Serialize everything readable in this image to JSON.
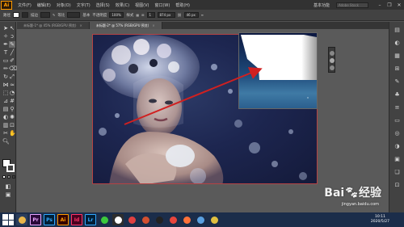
{
  "app": {
    "logo": "Ai",
    "menu": [
      "文件(F)",
      "编辑(E)",
      "对象(O)",
      "文字(T)",
      "选择(S)",
      "效果(C)",
      "视图(V)",
      "窗口(W)",
      "帮助(H)"
    ],
    "workspace": "基本功能",
    "search_placeholder": "Adobe Stock",
    "window_buttons": [
      "minimize-icon",
      "restore-icon",
      "close-icon"
    ]
  },
  "control_bar": {
    "object_label": "路径",
    "stroke_label": "描边",
    "stroke_weight": "",
    "brush_label": "等比",
    "brush_size": "",
    "style_label": "基本",
    "opacity_label": "不透明度",
    "opacity_value": "100%",
    "style2_label": "样式",
    "x_value": "1",
    "y_value": "874 px",
    "w_value": "46 px"
  },
  "doc_tabs": [
    {
      "label": "未标题-1* @ 45% (RGB/GPU 预览)",
      "active": false
    },
    {
      "label": "未标题-2* @ 57% (RGB/GPU 预览)",
      "active": true
    }
  ],
  "status_bar": {
    "zoom": "57%",
    "tool_name": "画板导航"
  },
  "taskbar": {
    "apps": [
      {
        "icon": "folder-icon",
        "label": "",
        "color": "#e9b64a",
        "bg": "#2a3e5e"
      },
      {
        "icon": "premiere-icon",
        "label": "Pr",
        "color": "#e8a4ff",
        "bg": "#2a0a3a"
      },
      {
        "icon": "photoshop-icon",
        "label": "Ps",
        "color": "#31a8ff",
        "bg": "#001e36"
      },
      {
        "icon": "illustrator-icon",
        "label": "Ai",
        "color": "#ff9a00",
        "bg": "#330000"
      },
      {
        "icon": "indesign-icon",
        "label": "Id",
        "color": "#ff3366",
        "bg": "#49021f"
      },
      {
        "icon": "lightroom-icon",
        "label": "Lr",
        "color": "#31a8ff",
        "bg": "#001e36"
      },
      {
        "icon": "wechat-icon",
        "label": "",
        "color": "#3cc83c",
        "bg": "#1b2d4a"
      },
      {
        "icon": "media-icon",
        "label": "",
        "color": "#ffffff",
        "bg": "#2e2e2e"
      },
      {
        "icon": "video-icon",
        "label": "",
        "color": "#e04040",
        "bg": "#1b2d4a"
      },
      {
        "icon": "player-icon",
        "label": "",
        "color": "#d25030",
        "bg": "#1b2d4a"
      },
      {
        "icon": "qq-icon",
        "label": "",
        "color": "#222222",
        "bg": "#1b2d4a"
      },
      {
        "icon": "chrome-icon",
        "label": "",
        "color": "#e8453c",
        "bg": "#1b2d4a"
      },
      {
        "icon": "firefox-icon",
        "label": "",
        "color": "#ff7139",
        "bg": "#1b2d4a"
      },
      {
        "icon": "paint-icon",
        "label": "",
        "color": "#5aa0e0",
        "bg": "#1b2d4a"
      },
      {
        "icon": "mail-icon",
        "label": "",
        "color": "#e0c040",
        "bg": "#1b2d4a"
      }
    ],
    "time": "10:11",
    "date": "2020/5/27"
  },
  "watermark": {
    "brand": "Bai",
    "brand2": "经验",
    "url": "jingyan.baidu.com"
  },
  "colors": {
    "artboard_border": "#b54343",
    "arrow": "#d02020",
    "accent": "#ff9a00"
  }
}
